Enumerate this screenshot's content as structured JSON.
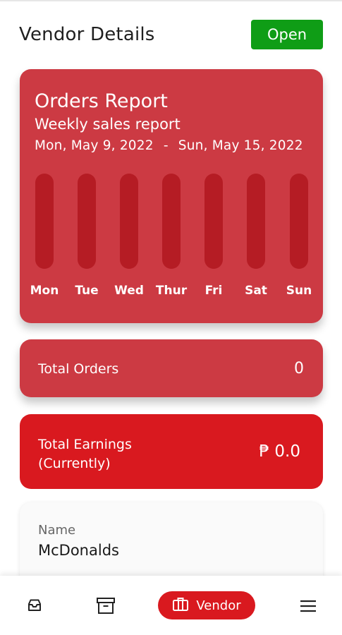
{
  "header": {
    "title": "Vendor Details",
    "status_button": "Open"
  },
  "report": {
    "title": "Orders Report",
    "subtitle": "Weekly sales report",
    "range_start": "Mon, May 9, 2022",
    "range_sep": "-",
    "range_end": "Sun, May 15, 2022",
    "days": [
      "Mon",
      "Tue",
      "Wed",
      "Thur",
      "Fri",
      "Sat",
      "Sun"
    ]
  },
  "chart_data": {
    "type": "bar",
    "categories": [
      "Mon",
      "Tue",
      "Wed",
      "Thur",
      "Fri",
      "Sat",
      "Sun"
    ],
    "values": [
      0,
      0,
      0,
      0,
      0,
      0,
      0
    ],
    "title": "Orders Report",
    "subtitle": "Weekly sales report"
  },
  "orders": {
    "label": "Total Orders",
    "value": "0"
  },
  "earnings": {
    "label_line1": "Total Earnings",
    "label_line2": "(Currently)",
    "value": "₱ 0.0"
  },
  "details": {
    "name_label": "Name",
    "name_value": "McDonalds"
  },
  "nav": {
    "active_label": "Vendor",
    "items": [
      "inbox-icon",
      "archive-icon",
      "vendor-icon",
      "menu-icon"
    ]
  },
  "colors": {
    "status_open": "#0f9d16",
    "report_card": "#cc3a43",
    "earnings_card": "#d9191f"
  }
}
